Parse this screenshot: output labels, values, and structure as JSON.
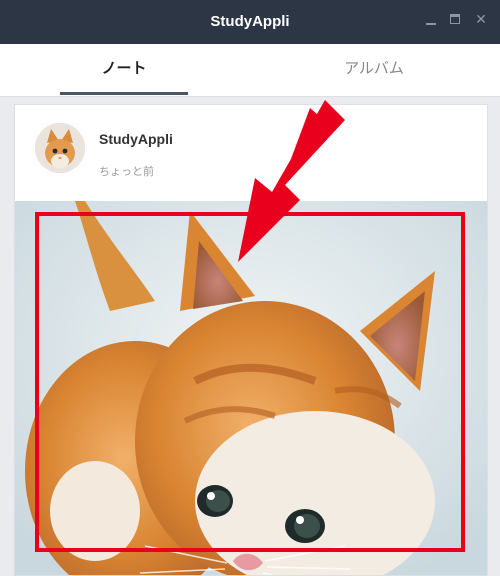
{
  "window": {
    "title": "StudyAppli",
    "controls": {
      "minimize_icon": "minimize-icon",
      "maximize_icon": "maximize-icon",
      "close_icon": "close-icon",
      "close_glyph": "✕"
    }
  },
  "tabs": [
    {
      "label": "ノート",
      "active": true
    },
    {
      "label": "アルバム",
      "active": false
    }
  ],
  "post": {
    "author": "StudyAppli",
    "timestamp": "ちょっと前",
    "photo_subject": "kitten"
  },
  "annotation": {
    "highlight_color": "#e8001c",
    "arrow_color": "#e8001c"
  }
}
